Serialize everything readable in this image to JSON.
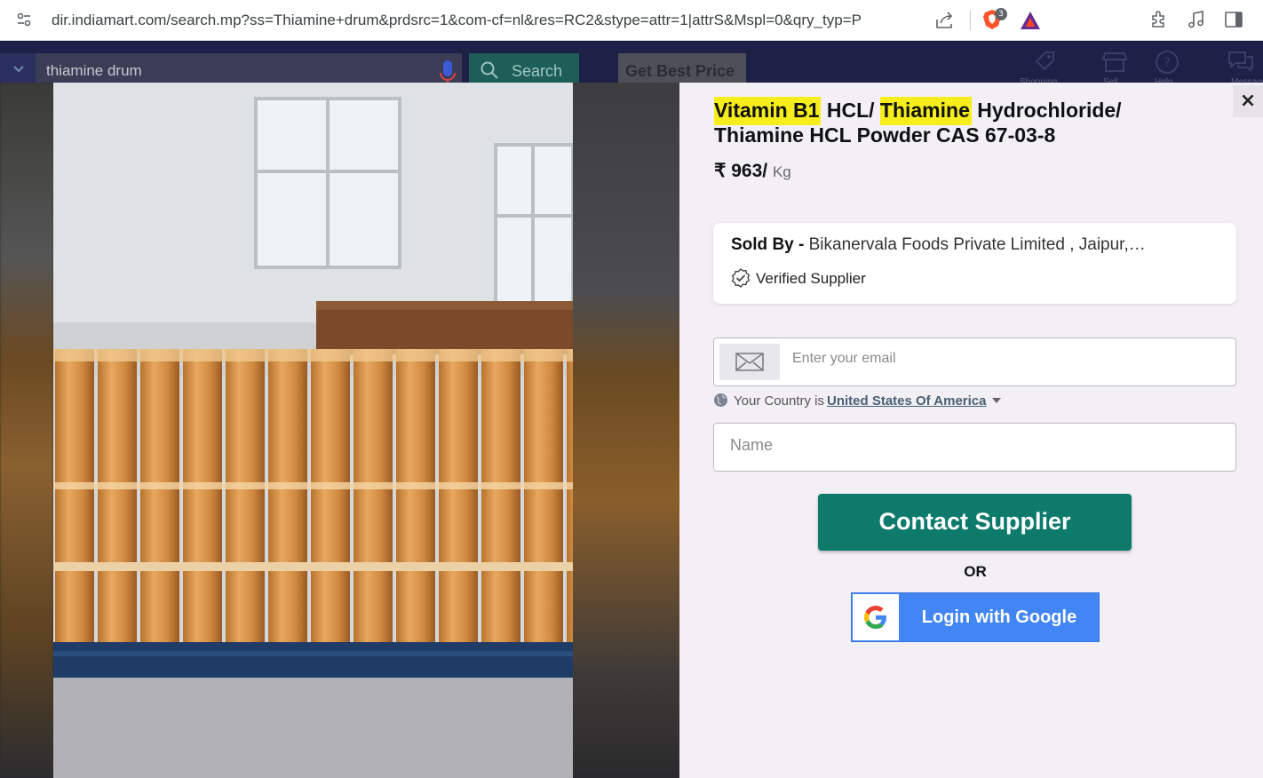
{
  "browser": {
    "url": "dir.indiamart.com/search.mp?ss=Thiamine+drum&prdsrc=1&com-cf=nl&res=RC2&stype=attr=1|attrS&Mspl=0&qry_typ=P",
    "brave_badge": "3"
  },
  "site": {
    "search_value": "thiamine drum",
    "search_button": "Search",
    "get_best_price": "Get Best Price",
    "nav_labels": [
      "Shopping",
      "Sell",
      "Help",
      "Messages"
    ]
  },
  "product": {
    "title_parts": [
      "Vitamin B1",
      " HCL/ ",
      "Thiamine",
      " Hydrochloride/ Thiamine HCL Powder CAS 67-03-8"
    ],
    "currency": "₹",
    "price": "963/",
    "unit": "Kg"
  },
  "seller": {
    "sold_by_label": "Sold By -",
    "name": "Bikanervala Foods Private Limited , Jaipur,…",
    "verified": "Verified Supplier"
  },
  "form": {
    "email_placeholder": "Enter your email",
    "country_prefix": "Your Country is",
    "country": "United States Of America",
    "name_placeholder": "Name",
    "contact_button": "Contact Supplier",
    "or": "OR",
    "google_button": "Login with Google"
  },
  "close_glyph": "×",
  "colors": {
    "highlight": "#f6ee1c",
    "contact": "#0d7a6c",
    "google": "#4285f4"
  }
}
